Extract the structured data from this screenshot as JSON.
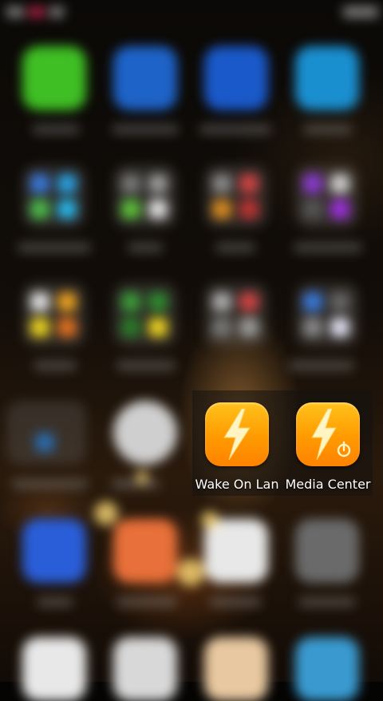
{
  "folder": {
    "apps": [
      {
        "label": "Wake On Lan",
        "icon": "lightning-bolt-icon"
      },
      {
        "label": "Media Center",
        "icon": "lightning-bolt-power-icon"
      }
    ]
  },
  "colors": {
    "app_icon_top": "#ffc21c",
    "app_icon_bottom": "#ff8200",
    "bolt": "#fff4c2"
  }
}
